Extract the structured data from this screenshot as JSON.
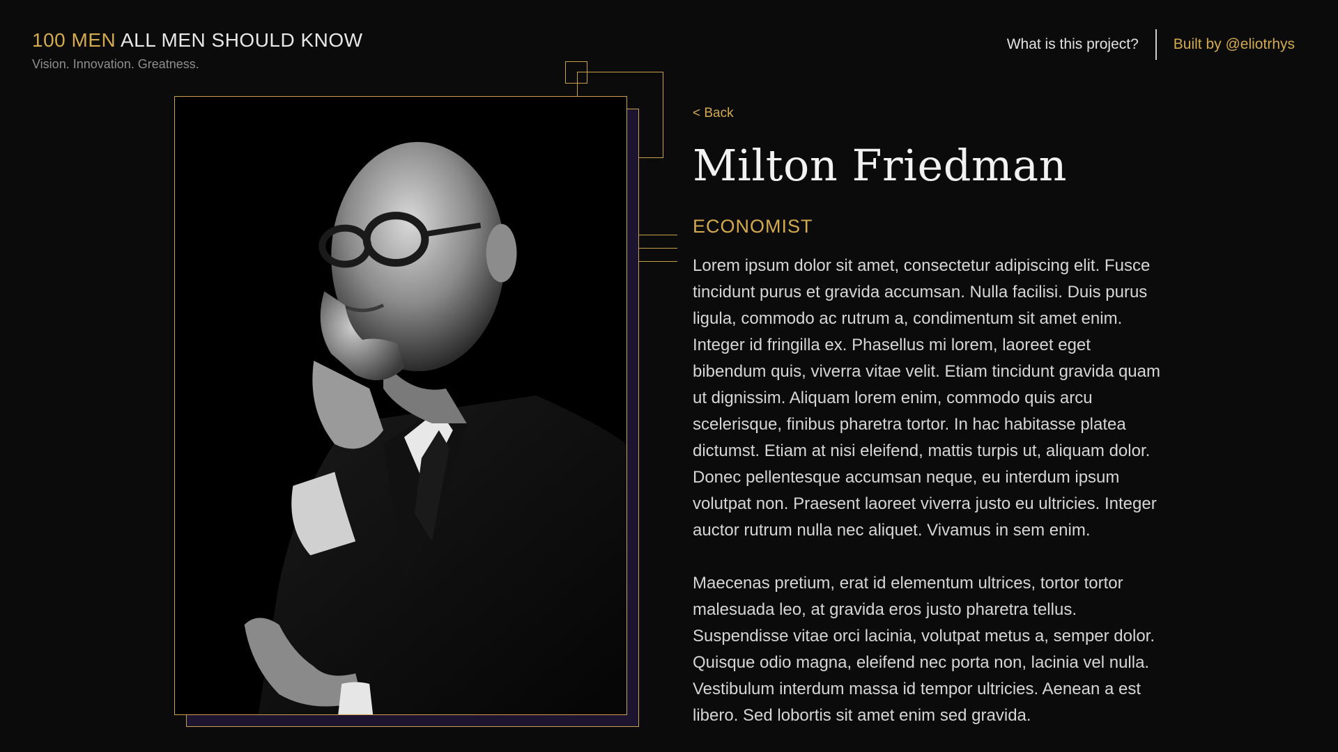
{
  "header": {
    "brand_accent": "100 MEN",
    "brand_rest": " ALL MEN SHOULD KNOW",
    "tagline": "Vision. Innovation. Greatness."
  },
  "nav": {
    "project_link": "What is this project?",
    "built_by_link": "Built by @eliotrhys"
  },
  "colors": {
    "background": "#0b0b0b",
    "accent_gold": "#d4aa4f",
    "shadow_purple": "#1d1530"
  },
  "profile": {
    "back_label": "< Back",
    "name": "Milton Friedman",
    "role": "ECONOMIST",
    "portrait_icon": "portrait-photo",
    "bio": [
      "Lorem ipsum dolor sit amet, consectetur adipiscing elit. Fusce tincidunt purus et gravida accumsan. Nulla facilisi. Duis purus ligula, commodo ac rutrum a, condimentum sit amet enim. Integer id fringilla ex. Phasellus mi lorem, laoreet eget bibendum quis, viverra vitae velit. Etiam tincidunt gravida quam ut dignissim. Aliquam lorem enim, commodo quis arcu scelerisque, finibus pharetra tortor. In hac habitasse platea dictumst. Etiam at nisi eleifend, mattis turpis ut, aliquam dolor. Donec pellentesque accumsan neque, eu interdum ipsum volutpat non. Praesent laoreet viverra justo eu ultricies. Integer auctor rutrum nulla nec aliquet. Vivamus in sem enim.",
      "Maecenas pretium, erat id elementum ultrices, tortor tortor malesuada leo, at gravida eros justo pharetra tellus. Suspendisse vitae orci lacinia, volutpat metus a, semper dolor. Quisque odio magna, eleifend nec porta non, lacinia vel nulla. Vestibulum interdum massa id tempor ultricies. Aenean a est libero. Sed lobortis sit amet enim sed gravida."
    ]
  }
}
